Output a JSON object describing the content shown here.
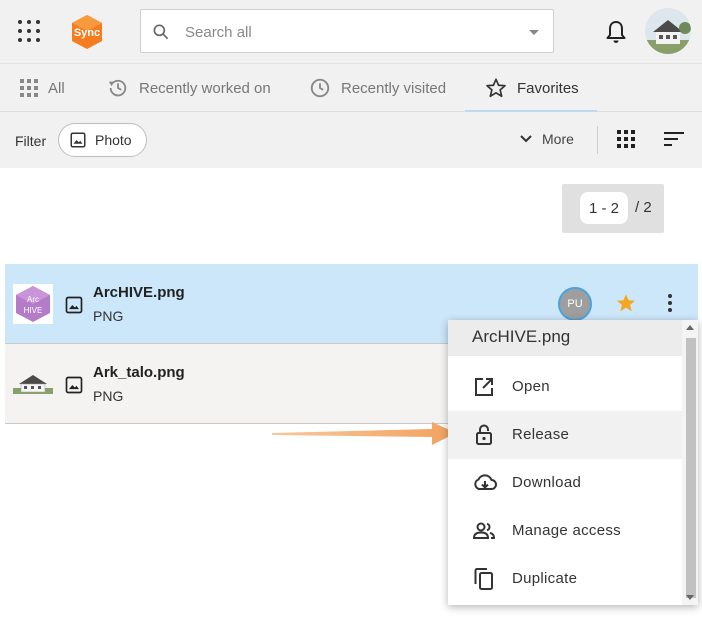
{
  "topbar": {
    "logo_text": "Sync",
    "search": {
      "placeholder": "Search all",
      "value": ""
    },
    "icons": [
      "apps-grid-icon",
      "search-icon",
      "chevron-down-icon",
      "bell-icon",
      "avatar-house-image"
    ]
  },
  "tabs": [
    {
      "label": "All",
      "icon": "grid-icon",
      "active": false
    },
    {
      "label": "Recently worked on",
      "icon": "history-icon",
      "active": false
    },
    {
      "label": "Recently visited",
      "icon": "clock-icon",
      "active": false
    },
    {
      "label": "Favorites",
      "icon": "star-outline-icon",
      "active": true
    }
  ],
  "filterbar": {
    "filter_label": "Filter",
    "chip_label": "Photo",
    "more_label": "More"
  },
  "pager": {
    "range": "1 - 2",
    "total": "/ 2"
  },
  "files": [
    {
      "name": "ArcHIVE.png",
      "type": "PNG",
      "thumb_text_1": "Arc",
      "thumb_text_2": "HIVE",
      "locked_by": "PU",
      "favorite": true,
      "selected": true
    },
    {
      "name": "Ark_talo.png",
      "type": "PNG",
      "favorite": true,
      "selected": false
    }
  ],
  "context_menu": {
    "title": "ArcHIVE.png",
    "items": [
      {
        "label": "Open",
        "icon": "open-external-icon"
      },
      {
        "label": "Release",
        "icon": "unlock-icon"
      },
      {
        "label": "Download",
        "icon": "cloud-download-icon"
      },
      {
        "label": "Manage access",
        "icon": "people-icon"
      },
      {
        "label": "Duplicate",
        "icon": "copy-icon"
      }
    ],
    "highlighted_item": "Release"
  },
  "colors": {
    "background": "#f1f1f1",
    "selected_row": "#cce6fa",
    "star": "#f5a623",
    "arrow": "#f2a25e",
    "logo": "#f57c1f",
    "thumb_purple": "#b47bc8"
  }
}
